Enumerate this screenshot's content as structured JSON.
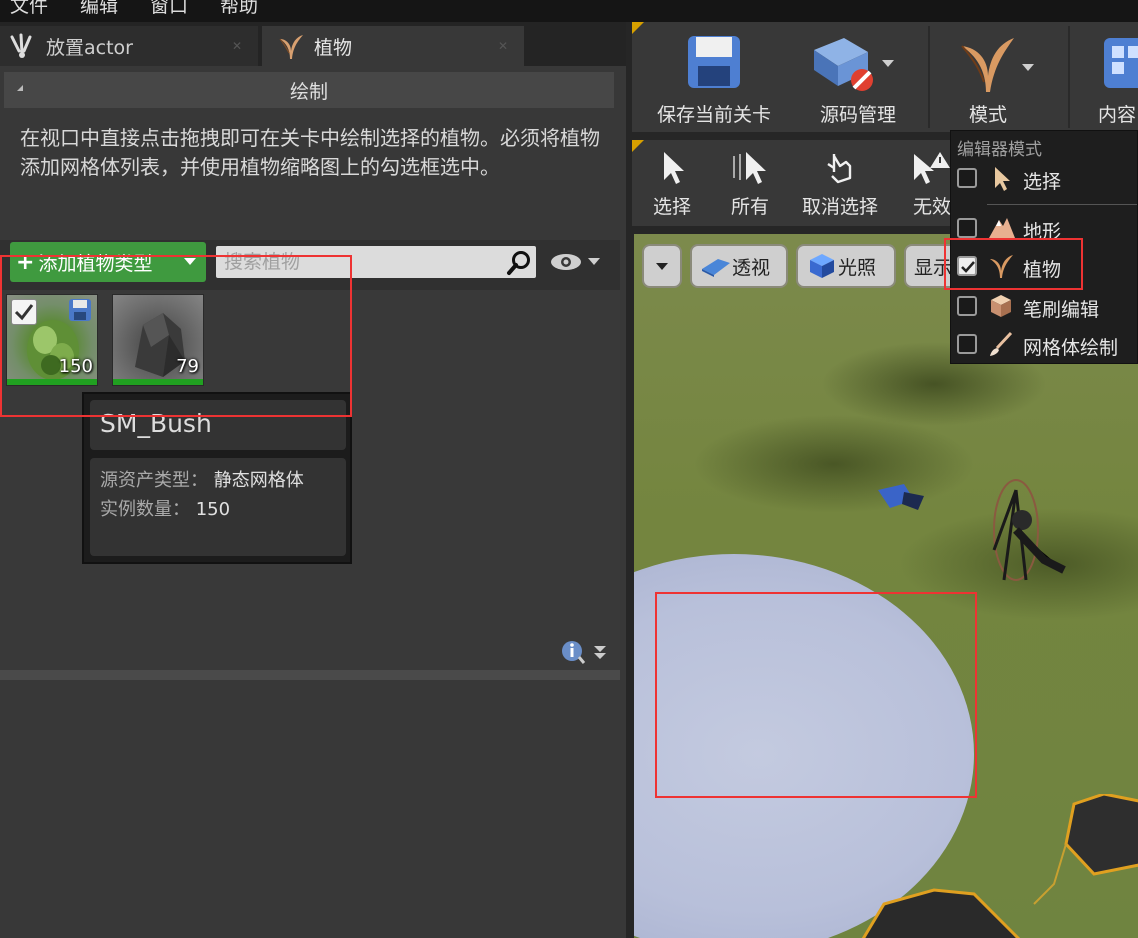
{
  "menubar": {
    "items": [
      "文件",
      "编辑",
      "窗口",
      "帮助"
    ]
  },
  "tabs": [
    {
      "label": "放置actor",
      "icon": "place-actor-icon"
    },
    {
      "label": "植物",
      "icon": "foliage-icon"
    }
  ],
  "paint_section": {
    "header": "绘制",
    "description": "在视口中直接点击拖拽即可在关卡中绘制选择的植物。必须将植物添加网格体列表，并使用植物缩略图上的勾选框选中。"
  },
  "foliage_toolbar": {
    "add_button": "添加植物类型",
    "search_placeholder": "搜索植物"
  },
  "foliage_types": [
    {
      "name": "SM_Bush",
      "count": "150",
      "checked": true
    },
    {
      "name": "rock",
      "count": "79",
      "checked": false
    }
  ],
  "tooltip": {
    "title": "SM_Bush",
    "asset_type_label": "源资产类型：",
    "asset_type_value": "静态网格体",
    "instance_label": "实例数量：",
    "instance_value": "150"
  },
  "main_toolbar": {
    "save": "保存当前关卡",
    "source": "源码管理",
    "modes": "模式",
    "content": "内容"
  },
  "select_toolbar": {
    "select": "选择",
    "all": "所有",
    "deselect": "取消选择",
    "invalid": "无效"
  },
  "viewport": {
    "perspective": "透视",
    "lighting": "光照",
    "show": "显示"
  },
  "modes_menu": {
    "header": "编辑器模式",
    "items": [
      {
        "label": "选择",
        "checked": false
      },
      {
        "label": "地形",
        "checked": false
      },
      {
        "label": "植物",
        "checked": true
      },
      {
        "label": "笔刷编辑",
        "checked": false
      },
      {
        "label": "网格体绘制",
        "checked": false
      }
    ]
  },
  "colors": {
    "add_green": "#3f9a3f",
    "highlight_red": "#e33333",
    "count_bar": "#21a121"
  }
}
